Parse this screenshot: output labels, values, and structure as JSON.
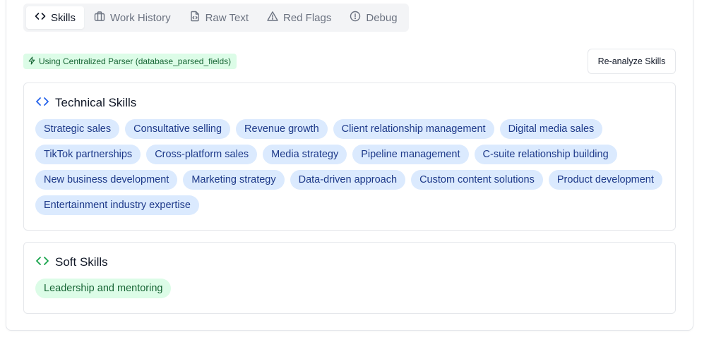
{
  "tabs": [
    {
      "label": "Skills",
      "icon": "code-icon",
      "active": true
    },
    {
      "label": "Work History",
      "icon": "briefcase-icon",
      "active": false
    },
    {
      "label": "Raw Text",
      "icon": "file-icon",
      "active": false
    },
    {
      "label": "Red Flags",
      "icon": "warning-icon",
      "active": false
    },
    {
      "label": "Debug",
      "icon": "alert-circle-icon",
      "active": false
    }
  ],
  "parser_badge": {
    "icon": "lightning-icon",
    "text": "Using Centralized Parser (database_parsed_fields)"
  },
  "reanalyze_button": "Re-analyze Skills",
  "technical": {
    "title": "Technical Skills",
    "icon": "code-icon",
    "accent": "#2563eb",
    "skills": [
      "Strategic sales",
      "Consultative selling",
      "Revenue growth",
      "Client relationship management",
      "Digital media sales",
      "TikTok partnerships",
      "Cross-platform sales",
      "Media strategy",
      "Pipeline management",
      "C-suite relationship building",
      "New business development",
      "Marketing strategy",
      "Data-driven approach",
      "Custom content solutions",
      "Product development",
      "Entertainment industry expertise"
    ]
  },
  "soft": {
    "title": "Soft Skills",
    "icon": "code-icon",
    "accent": "#16a34a",
    "skills": [
      "Leadership and mentoring"
    ]
  }
}
